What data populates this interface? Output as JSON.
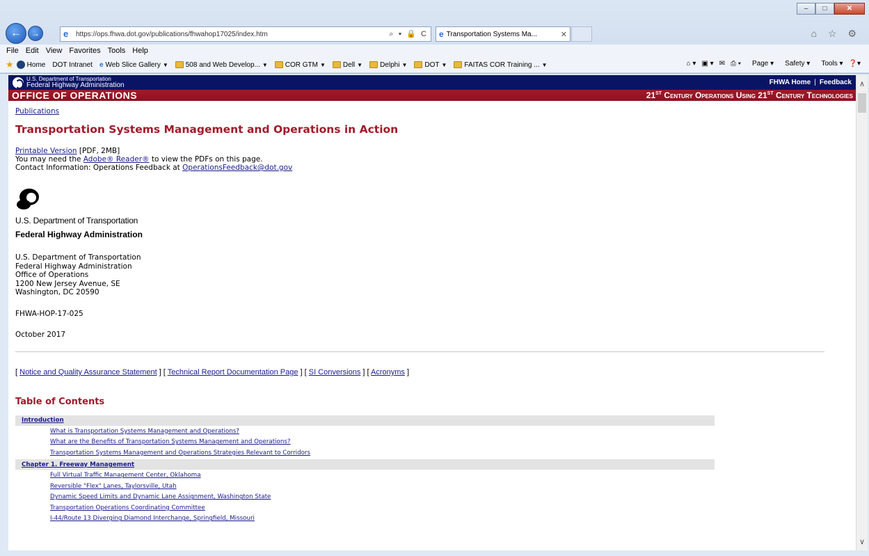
{
  "window": {
    "min_label": "–",
    "max_label": "□",
    "close_label": "✕"
  },
  "browser": {
    "url": "https://ops.fhwa.dot.gov/publications/fhwahop17025/index.htm",
    "address_tools": "⌕ ▾ 🔒 C",
    "tab_title": "Transportation Systems Ma...",
    "tab_close": "✕",
    "chrome_icons": "⌂ ☆ ⚙",
    "menu": [
      "File",
      "Edit",
      "View",
      "Favorites",
      "Tools",
      "Help"
    ],
    "favorites": {
      "home": "Home",
      "intranet": "DOT Intranet",
      "web_slice": "Web Slice Gallery",
      "f1": "508 and Web Develop...",
      "f2": "COR GTM",
      "f3": "Dell",
      "f4": "Delphi",
      "f5": "DOT",
      "f6": "FAITAS COR Training ..."
    },
    "commands": {
      "page": "Page",
      "safety": "Safety",
      "tools": "Tools"
    }
  },
  "site": {
    "brand_line1": "U.S. Department of Transportation",
    "brand_line2": "Federal Highway Administration",
    "link_home": "FHWA Home",
    "link_feedback": "Feedback",
    "banner_title": "OFFICE OF OPERATIONS",
    "tagline_a": "21",
    "tagline_sup_a": "ST",
    "tagline_b": " Century Operations Using 21",
    "tagline_sup_b": "ST",
    "tagline_c": " Century Technologies"
  },
  "page": {
    "breadcrumb": "Publications",
    "title": "Transportation Systems Management and Operations in Action",
    "printable_link": "Printable Version",
    "printable_info": " [PDF, 2MB]",
    "reader_pre": "You may need the ",
    "reader_link": "Adobe® Reader®",
    "reader_post": " to view the PDFs on this page.",
    "contact_pre": "Contact Information: Operations Feedback at ",
    "contact_link": "OperationsFeedback@dot.gov",
    "logo_line1": "U.S. Department of Transportation",
    "logo_line2": "Federal Highway Administration",
    "address": [
      "U.S. Department of Transportation",
      "Federal Highway Administration",
      "Office of Operations",
      "1200 New Jersey Avenue, SE",
      "Washington, DC 20590"
    ],
    "report_no": "FHWA-HOP-17-025",
    "date": "October 2017",
    "bracket_links": [
      "Notice and Quality Assurance Statement",
      "Technical Report Documentation Page",
      "SI Conversions",
      "Acronyms"
    ],
    "toc_heading": "Table of Contents",
    "toc": [
      {
        "section": "Introduction",
        "items": [
          "What is Transportation Systems Management and Operations?",
          "What are the Benefits of Transportation Systems Management and Operations?",
          "Transportation Systems Management and Operations Strategies Relevant to Corridors"
        ]
      },
      {
        "section": "Chapter 1. Freeway Management",
        "items": [
          "Full Virtual Traffic Management Center, Oklahoma",
          "Reversible \"Flex\" Lanes, Taylorsville, Utah",
          "Dynamic Speed Limits and Dynamic Lane Assignment, Washington State",
          "Transportation Operations Coordinating Committee",
          "I-44/Route 13 Diverging Diamond Interchange, Springfield, Missouri"
        ]
      }
    ]
  }
}
